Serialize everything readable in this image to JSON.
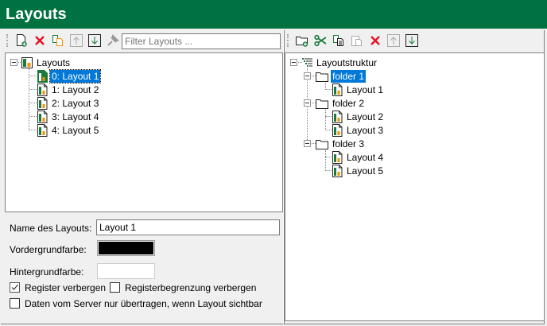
{
  "header": {
    "title": "Layouts"
  },
  "left": {
    "toolbar": {
      "filter_placeholder": "Filter Layouts ...",
      "icons": [
        "new-layout-icon",
        "delete-icon",
        "copy-icon",
        "move-up-icon",
        "move-down-icon",
        "pin-icon"
      ]
    },
    "tree": {
      "root": "Layouts",
      "items": [
        "0: Layout 1",
        "1: Layout 2",
        "2: Layout 3",
        "3: Layout 4",
        "4: Layout 5"
      ],
      "selected": 0
    },
    "form": {
      "name_label": "Name des Layouts:",
      "name_value": "Layout 1",
      "fg_label": "Vordergrundfarbe:",
      "fg_color": "#000000",
      "bg_label": "Hintergrundfarbe:",
      "bg_color": "#ffffff",
      "hide_register": {
        "label": "Register verbergen",
        "checked": true
      },
      "hide_register_border": {
        "label": "Registerbegrenzung verbergen",
        "checked": false
      },
      "transfer_visible": {
        "label": "Daten vom Server nur übertragen, wenn Layout sichtbar",
        "checked": false
      }
    }
  },
  "right": {
    "toolbar": {
      "icons": [
        "new-folder-icon",
        "cut-icon",
        "copy-icon",
        "paste-icon",
        "delete-icon",
        "move-up-icon",
        "move-down-icon"
      ]
    },
    "tree": {
      "root": "Layoutstruktur",
      "folders": [
        {
          "name": "folder 1",
          "items": [
            "Layout 1"
          ]
        },
        {
          "name": "folder 2",
          "items": [
            "Layout 2",
            "Layout 3"
          ]
        },
        {
          "name": "folder 3",
          "items": [
            "Layout 4",
            "Layout 5"
          ]
        }
      ],
      "selected": "folder 1"
    }
  },
  "colors": {
    "brand": "#007242",
    "selection": "#0078d7"
  }
}
